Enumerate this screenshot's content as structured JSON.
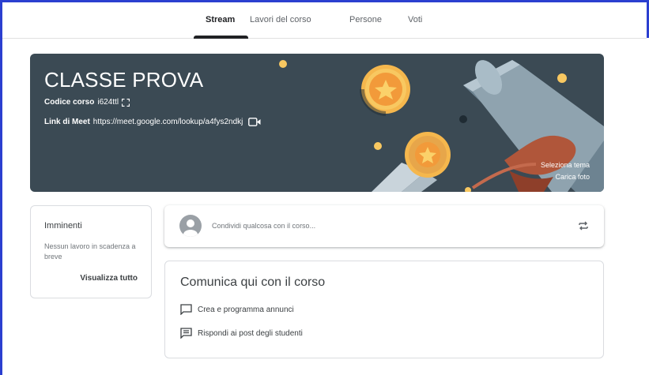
{
  "nav": {
    "tabs": [
      {
        "label": "Stream",
        "active": true
      },
      {
        "label": "Lavori del corso",
        "active": false
      },
      {
        "label": "Persone",
        "active": false
      },
      {
        "label": "Voti",
        "active": false
      }
    ]
  },
  "banner": {
    "title": "CLASSE PROVA",
    "code_label": "Codice corso",
    "code_value": "i624ttl",
    "meet_label": "Link di Meet",
    "meet_url": "https://meet.google.com/lookup/a4fys2ndkj",
    "select_theme": "Seleziona tema",
    "upload_photo": "Carica foto",
    "expand_icon": "fullscreen-icon",
    "video_icon": "videocam-icon",
    "bg_color": "#3b4a54"
  },
  "upcoming": {
    "title": "Imminenti",
    "text": "Nessun lavoro in scadenza a breve",
    "link": "Visualizza tutto"
  },
  "share": {
    "placeholder": "Condividi qualcosa con il corso...",
    "repost_icon": "repost-icon"
  },
  "communicate": {
    "title": "Comunica qui con il corso",
    "items": [
      {
        "icon": "announcement-icon",
        "label": "Crea e programma annunci"
      },
      {
        "icon": "chat-icon",
        "label": "Rispondi ai post degli studenti"
      }
    ]
  }
}
